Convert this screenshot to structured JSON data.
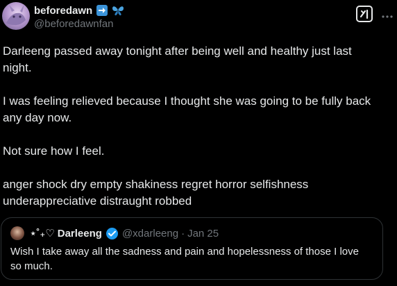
{
  "tweet": {
    "display_name": "beforedawn",
    "handle": "@beforedawnfan",
    "paragraphs": [
      "Darleeng passed away tonight after being well and healthy just last night.",
      "I was feeling relieved because I thought she was going to be fully back any day now.",
      "Not sure how I feel.",
      "anger shock dry empty shakiness regret horror selfishness underappreciative distraught robbed"
    ]
  },
  "quoted": {
    "name_prefix": "⋆˚₊♡",
    "display_name": "Darleeng",
    "handle": "@xdarleeng",
    "separator": "·",
    "date": "Jan 25",
    "text": "Wish I take away all the sadness and pain and hopelessness of those I love so much."
  },
  "colors": {
    "background": "#000000",
    "text": "#e7e9ea",
    "secondary": "#71767b",
    "border": "#2f3336",
    "verified_blue": "#1d9bf0"
  },
  "icons": {
    "arrow_emoji": "right-arrow-emoji-icon",
    "butterfly_emoji": "butterfly-emoji-icon",
    "grok": "grok-icon",
    "more": "more-horizontal-icon",
    "verified": "verified-badge-icon"
  }
}
